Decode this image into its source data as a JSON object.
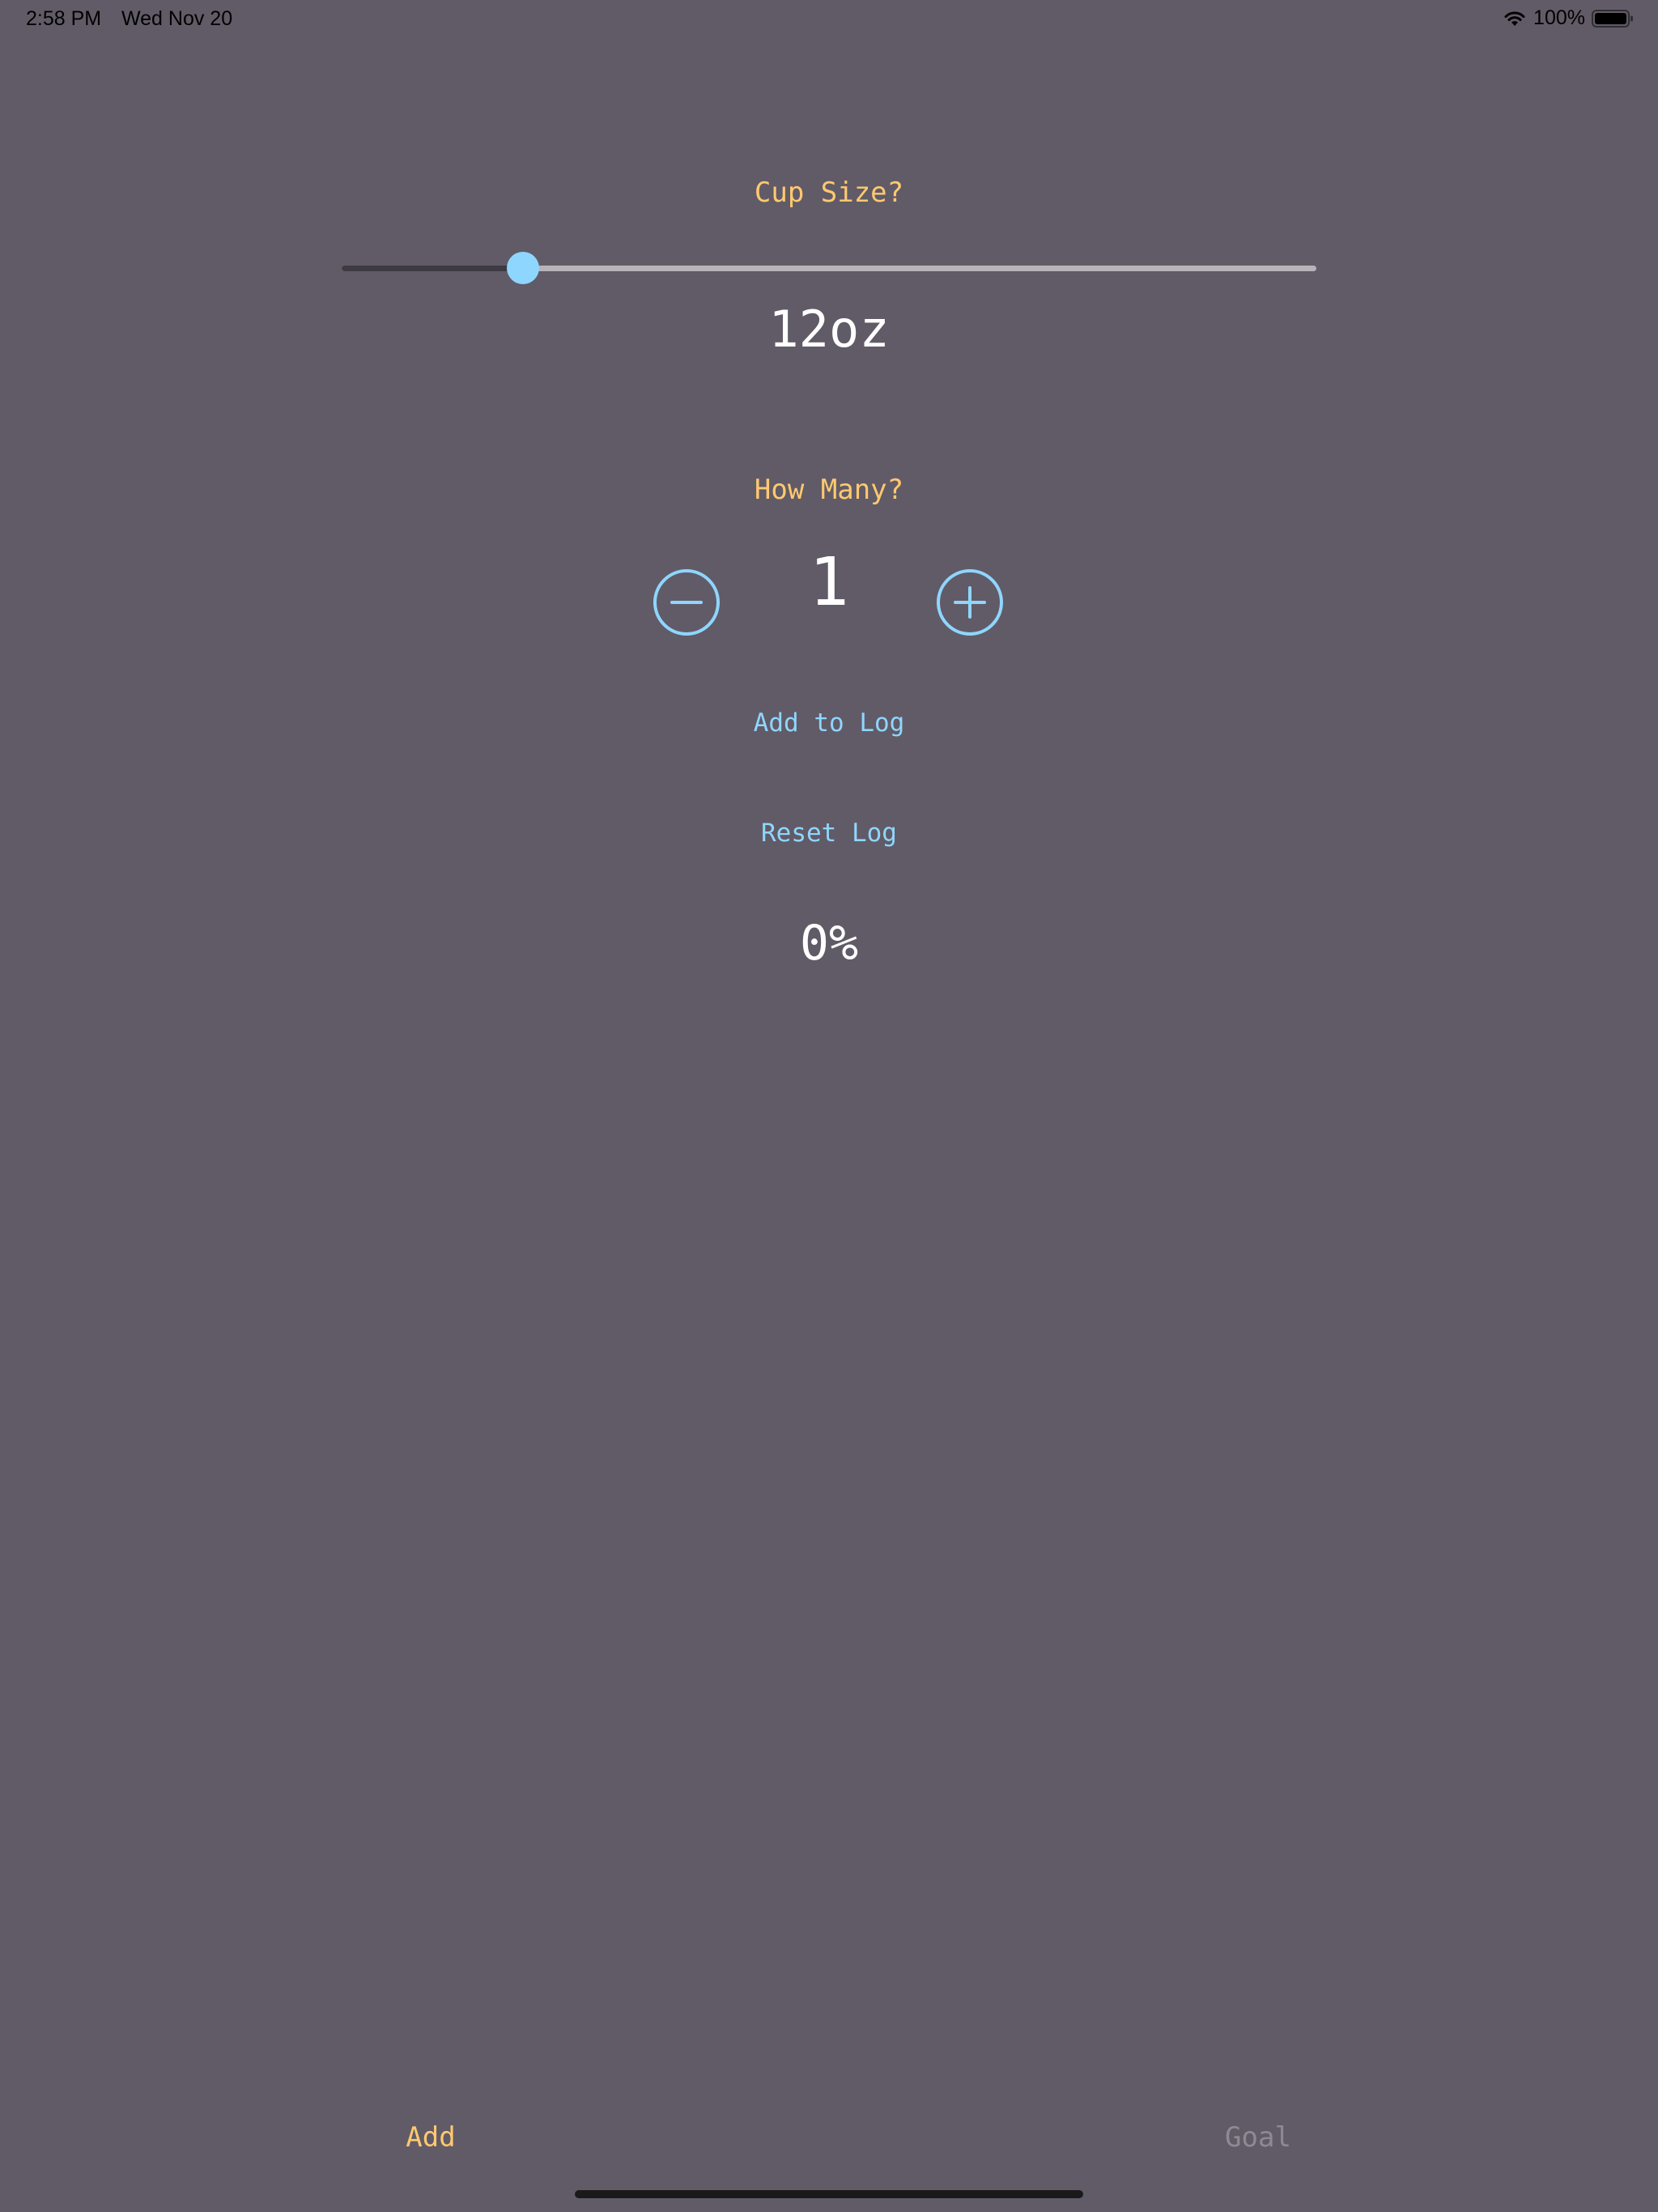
{
  "status_bar": {
    "time": "2:58 PM",
    "date": "Wed Nov 20",
    "battery": "100%",
    "icons": [
      "wifi-icon",
      "battery-icon"
    ]
  },
  "cup_size": {
    "heading": "Cup Size?",
    "slider_fraction": 0.186,
    "value_label": "12oz"
  },
  "how_many": {
    "heading": "How Many?",
    "count": "1",
    "decrement_icon": "minus-circle-icon",
    "increment_icon": "plus-circle-icon"
  },
  "actions": {
    "add_to_log": "Add to Log",
    "reset_log": "Reset Log"
  },
  "progress": {
    "percent_label": "0%"
  },
  "tab_bar": {
    "tabs": [
      {
        "label": "Add",
        "selected": true
      },
      {
        "label": "Goal",
        "selected": false
      }
    ]
  },
  "colors": {
    "background": "#615b67",
    "accent_yellow": "#ffc970",
    "accent_blue": "#8fd6ff",
    "inactive_tab": "#8e8992"
  }
}
